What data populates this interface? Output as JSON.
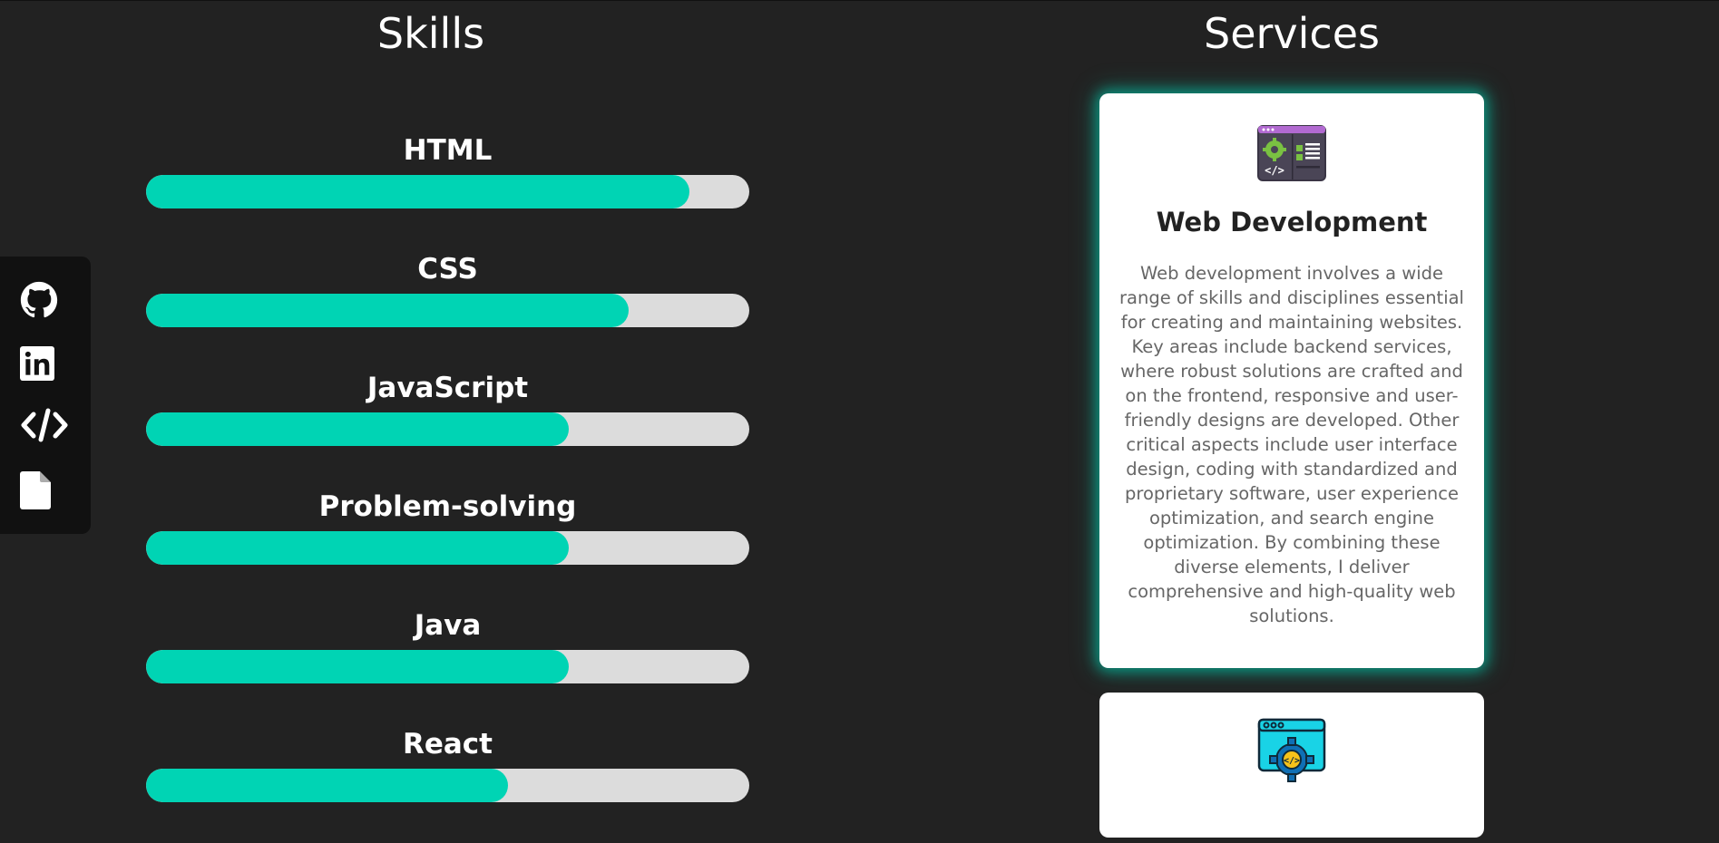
{
  "skills": {
    "title": "Skills",
    "items": [
      {
        "name": "HTML",
        "level": 0.9
      },
      {
        "name": "CSS",
        "level": 0.8
      },
      {
        "name": "JavaScript",
        "level": 0.7
      },
      {
        "name": "Problem-solving",
        "level": 0.7
      },
      {
        "name": "Java",
        "level": 0.7
      },
      {
        "name": "React",
        "level": 0.6
      }
    ]
  },
  "services": {
    "title": "Services",
    "cards": [
      {
        "title": "Web Development",
        "icon": "web-development-icon",
        "description": "Web development involves a wide range of skills and disciplines essential for creating and maintaining websites. Key areas include backend services, where robust solutions are crafted and on the frontend, responsive and user-friendly designs are developed. Other critical aspects include user interface design, coding with standardized and proprietary software, user experience optimization, and search engine optimization. By combining these diverse elements, I deliver comprehensive and high-quality web solutions."
      },
      {
        "icon": "web-settings-icon"
      }
    ]
  },
  "social": {
    "items": [
      {
        "icon": "github-icon"
      },
      {
        "icon": "linkedin-icon"
      },
      {
        "icon": "code-icon"
      },
      {
        "icon": "document-icon"
      }
    ]
  },
  "colors": {
    "background": "#222222",
    "accent": "#00d4b4",
    "track": "#dcdcdc"
  }
}
